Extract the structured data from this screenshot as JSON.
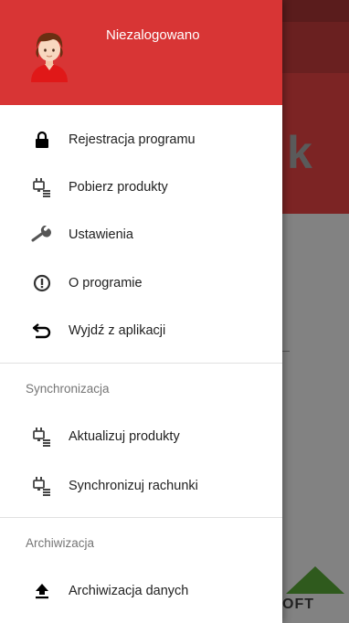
{
  "background": {
    "hero_fragment": "k",
    "logo_fragment": "OFT"
  },
  "drawer": {
    "header": {
      "user_status": "Niezalogowano",
      "avatar_icon": "user-avatar-icon",
      "header_color": "#d83535"
    },
    "items": [
      {
        "label": "Rejestracja programu",
        "icon": "lock-icon"
      },
      {
        "label": "Pobierz produkty",
        "icon": "plug-icon"
      },
      {
        "label": "Ustawienia",
        "icon": "wrench-icon"
      },
      {
        "label": "O programie",
        "icon": "info-icon"
      },
      {
        "label": "Wyjdź z aplikacji",
        "icon": "exit-icon"
      }
    ],
    "sections": [
      {
        "title": "Synchronizacja",
        "items": [
          {
            "label": "Aktualizuj produkty",
            "icon": "plug-icon"
          },
          {
            "label": "Synchronizuj rachunki",
            "icon": "plug-icon"
          }
        ]
      },
      {
        "title": "Archiwizacja",
        "items": [
          {
            "label": "Archiwizacja danych",
            "icon": "upload-icon"
          }
        ]
      }
    ]
  }
}
